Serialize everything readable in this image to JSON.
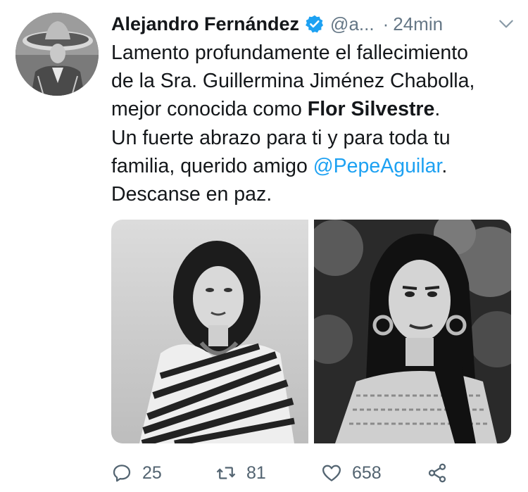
{
  "user": {
    "name": "Alejandro Fernández",
    "handle": "@a...",
    "separator": "·",
    "time": "24min"
  },
  "tweet": {
    "line1": "Lamento profundamente el fallecimiento",
    "line2": "de la Sra. Guillermina Jiménez Chabolla,",
    "line3_prefix": "mejor conocida como ",
    "line3_bold": "Flor Silvestre",
    "line3_suffix": ".",
    "line4": "Un fuerte abrazo para ti y para toda tu",
    "line5_prefix": "familia, querido amigo ",
    "line5_mention": "@PepeAguilar",
    "line5_suffix": ".",
    "line6": "Descanse en paz."
  },
  "stats": {
    "replies": "25",
    "retweets": "81",
    "likes": "658"
  },
  "colors": {
    "accent": "#1da1f2",
    "muted": "#657786",
    "text": "#14171a"
  },
  "icons": [
    "verified-badge-icon",
    "chevron-down-icon",
    "reply-icon",
    "retweet-icon",
    "like-icon",
    "share-icon"
  ]
}
